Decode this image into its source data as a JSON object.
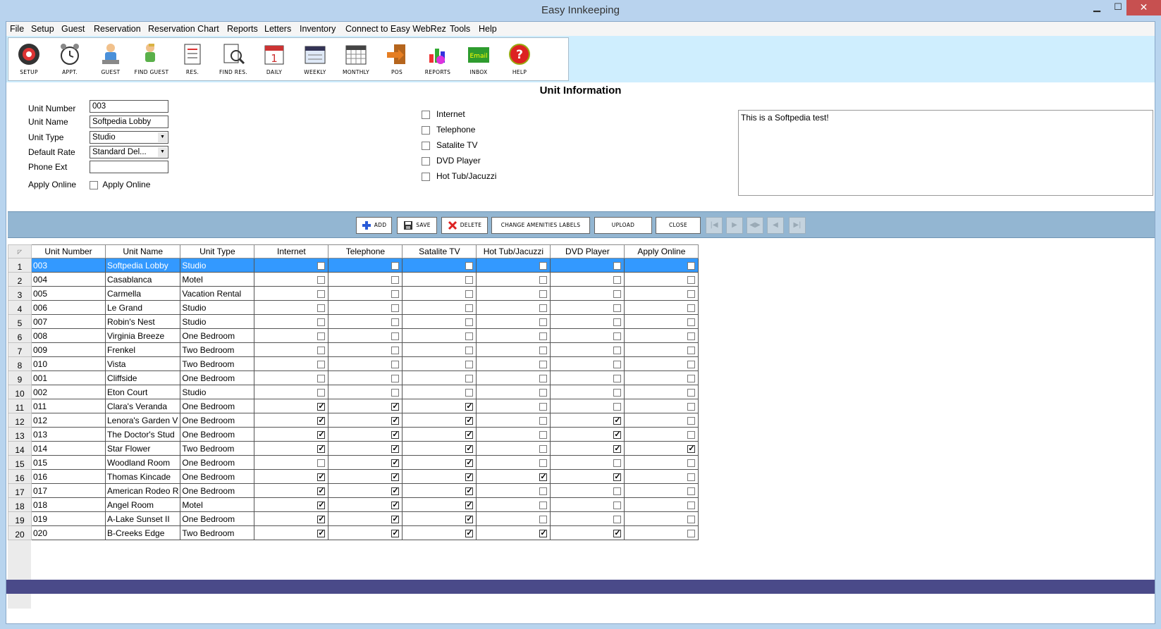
{
  "window": {
    "title": "Easy Innkeeping",
    "min": "▁",
    "max": "☐",
    "close": "✕"
  },
  "menu": [
    "File",
    "Setup",
    "Guest",
    "Reservation",
    "Reservation Chart",
    "Reports",
    "Letters",
    "Inventory",
    "Connect to Easy WebRez",
    "Tools",
    "Help"
  ],
  "toolbar": [
    {
      "label": "SETUP",
      "icon": "setup-icon"
    },
    {
      "label": "APPT.",
      "icon": "alarm-clock-icon"
    },
    {
      "label": "GUEST",
      "icon": "guest-icon"
    },
    {
      "label": "FIND GUEST",
      "icon": "find-guest-icon"
    },
    {
      "label": "RES.",
      "icon": "reservation-icon"
    },
    {
      "label": "FIND RES.",
      "icon": "find-reservation-icon"
    },
    {
      "label": "DAILY",
      "icon": "daily-calendar-icon"
    },
    {
      "label": "WEEKLY",
      "icon": "weekly-calendar-icon"
    },
    {
      "label": "MONTHLY",
      "icon": "monthly-calendar-icon"
    },
    {
      "label": "POS",
      "icon": "pos-icon"
    },
    {
      "label": "REPORTS",
      "icon": "reports-icon"
    },
    {
      "label": "INBOX",
      "icon": "email-inbox-icon"
    },
    {
      "label": "HELP",
      "icon": "help-icon"
    }
  ],
  "form": {
    "title": "Unit Information",
    "unit_number_label": "Unit Number",
    "unit_number": "003",
    "unit_name_label": "Unit Name",
    "unit_name": "Softpedia Lobby",
    "unit_type_label": "Unit Type",
    "unit_type": "Studio",
    "default_rate_label": "Default Rate",
    "default_rate": "Standard Del...",
    "phone_ext_label": "Phone Ext",
    "phone_ext": "",
    "apply_online_label": "Apply Online",
    "apply_online_cb_label": "Apply Online",
    "amenities": [
      "Internet",
      "Telephone",
      "Satalite TV",
      "DVD Player",
      "Hot Tub/Jacuzzi"
    ],
    "notes": "This is a Softpedia test!"
  },
  "actions": {
    "add": "ADD",
    "save": "SAVE",
    "delete": "DELETE",
    "change_labels": "CHANGE AMENITIES LABELS",
    "upload": "UPLOAD",
    "close": "CLOSE"
  },
  "grid": {
    "columns": [
      "Unit Number",
      "Unit Name",
      "Unit Type",
      "Internet",
      "Telephone",
      "Satalite TV",
      "Hot Tub/Jacuzzi",
      "DVD Player",
      "Apply Online"
    ],
    "rows": [
      {
        "n": "1",
        "num": "003",
        "name": "Softpedia Lobby",
        "type": "Studio",
        "f": [
          0,
          0,
          0,
          0,
          0,
          0
        ]
      },
      {
        "n": "2",
        "num": "004",
        "name": "Casablanca",
        "type": "Motel",
        "f": [
          0,
          0,
          0,
          0,
          0,
          0
        ]
      },
      {
        "n": "3",
        "num": "005",
        "name": "Carmella",
        "type": "Vacation Rental",
        "f": [
          0,
          0,
          0,
          0,
          0,
          0
        ]
      },
      {
        "n": "4",
        "num": "006",
        "name": "Le Grand",
        "type": "Studio",
        "f": [
          0,
          0,
          0,
          0,
          0,
          0
        ]
      },
      {
        "n": "5",
        "num": "007",
        "name": "Robin's Nest",
        "type": "Studio",
        "f": [
          0,
          0,
          0,
          0,
          0,
          0
        ]
      },
      {
        "n": "6",
        "num": "008",
        "name": "Virginia Breeze",
        "type": "One Bedroom",
        "f": [
          0,
          0,
          0,
          0,
          0,
          0
        ]
      },
      {
        "n": "7",
        "num": "009",
        "name": "Frenkel",
        "type": "Two Bedroom",
        "f": [
          0,
          0,
          0,
          0,
          0,
          0
        ]
      },
      {
        "n": "8",
        "num": "010",
        "name": "Vista",
        "type": "Two Bedroom",
        "f": [
          0,
          0,
          0,
          0,
          0,
          0
        ]
      },
      {
        "n": "9",
        "num": "001",
        "name": "Cliffside",
        "type": "One Bedroom",
        "f": [
          0,
          0,
          0,
          0,
          0,
          0
        ]
      },
      {
        "n": "10",
        "num": "002",
        "name": "Eton Court",
        "type": "Studio",
        "f": [
          0,
          0,
          0,
          0,
          0,
          0
        ]
      },
      {
        "n": "11",
        "num": "011",
        "name": "Clara's Veranda",
        "type": "One Bedroom",
        "f": [
          1,
          1,
          1,
          0,
          0,
          0
        ]
      },
      {
        "n": "12",
        "num": "012",
        "name": "Lenora's Garden V",
        "type": "One Bedroom",
        "f": [
          1,
          1,
          1,
          0,
          1,
          0
        ]
      },
      {
        "n": "13",
        "num": "013",
        "name": "The Doctor's Stud",
        "type": "One Bedroom",
        "f": [
          1,
          1,
          1,
          0,
          1,
          0
        ]
      },
      {
        "n": "14",
        "num": "014",
        "name": "Star Flower",
        "type": "Two Bedroom",
        "f": [
          1,
          1,
          1,
          0,
          1,
          1
        ]
      },
      {
        "n": "15",
        "num": "015",
        "name": "Woodland Room",
        "type": "One Bedroom",
        "f": [
          0,
          1,
          1,
          0,
          0,
          0
        ]
      },
      {
        "n": "16",
        "num": "016",
        "name": "Thomas Kincade",
        "type": "One Bedroom",
        "f": [
          1,
          1,
          1,
          1,
          1,
          0
        ]
      },
      {
        "n": "17",
        "num": "017",
        "name": "American Rodeo R",
        "type": "One Bedroom",
        "f": [
          1,
          1,
          1,
          0,
          0,
          0
        ]
      },
      {
        "n": "18",
        "num": "018",
        "name": "Angel Room",
        "type": "Motel",
        "f": [
          1,
          1,
          1,
          0,
          0,
          0
        ]
      },
      {
        "n": "19",
        "num": "019",
        "name": "A-Lake Sunset II",
        "type": "One Bedroom",
        "f": [
          1,
          1,
          1,
          0,
          0,
          0
        ]
      },
      {
        "n": "20",
        "num": "020",
        "name": "B-Creeks Edge",
        "type": "Two Bedroom",
        "f": [
          1,
          1,
          1,
          1,
          1,
          0
        ]
      }
    ]
  },
  "colors": {
    "titlebar": "#b9d3ee",
    "toolbar_bg": "#cfeefe",
    "actionbar": "#93b6d2",
    "selection": "#3399ff",
    "statusbar": "#4a4a89",
    "close_button": "#c75050"
  }
}
